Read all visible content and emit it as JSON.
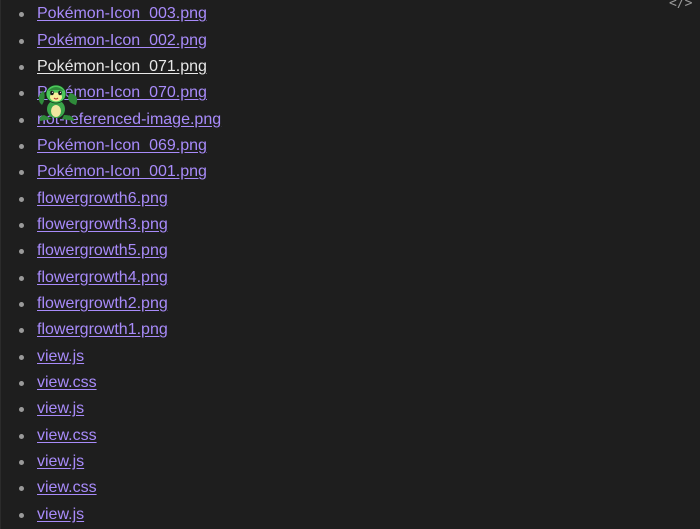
{
  "toolbar": {
    "code_toggle_glyph": "</>"
  },
  "files": [
    {
      "label": "Pokémon-Icon_003.png",
      "active": false
    },
    {
      "label": "Pokémon-Icon_002.png",
      "active": false
    },
    {
      "label": "Pokémon-Icon_071.png",
      "active": true
    },
    {
      "label": "Pokémon-Icon_070.png",
      "active": false
    },
    {
      "label": "not-referenced-image.png",
      "active": false
    },
    {
      "label": "Pokémon-Icon_069.png",
      "active": false
    },
    {
      "label": "Pokémon-Icon_001.png",
      "active": false
    },
    {
      "label": "flowergrowth6.png",
      "active": false
    },
    {
      "label": "flowergrowth3.png",
      "active": false
    },
    {
      "label": "flowergrowth5.png",
      "active": false
    },
    {
      "label": "flowergrowth4.png",
      "active": false
    },
    {
      "label": "flowergrowth2.png",
      "active": false
    },
    {
      "label": "flowergrowth1.png",
      "active": false
    },
    {
      "label": "view.js",
      "active": false
    },
    {
      "label": "view.css",
      "active": false
    },
    {
      "label": "view.js",
      "active": false
    },
    {
      "label": "view.css",
      "active": false
    },
    {
      "label": "view.js",
      "active": false
    },
    {
      "label": "view.css",
      "active": false
    },
    {
      "label": "view.js",
      "active": false
    }
  ],
  "colors": {
    "background": "#1e1e1e",
    "link": "#a88bfa",
    "active_link": "#e8e8e8",
    "bullet": "#9a9a9a"
  },
  "preview": {
    "icon": "pokemon-sprite-icon"
  }
}
